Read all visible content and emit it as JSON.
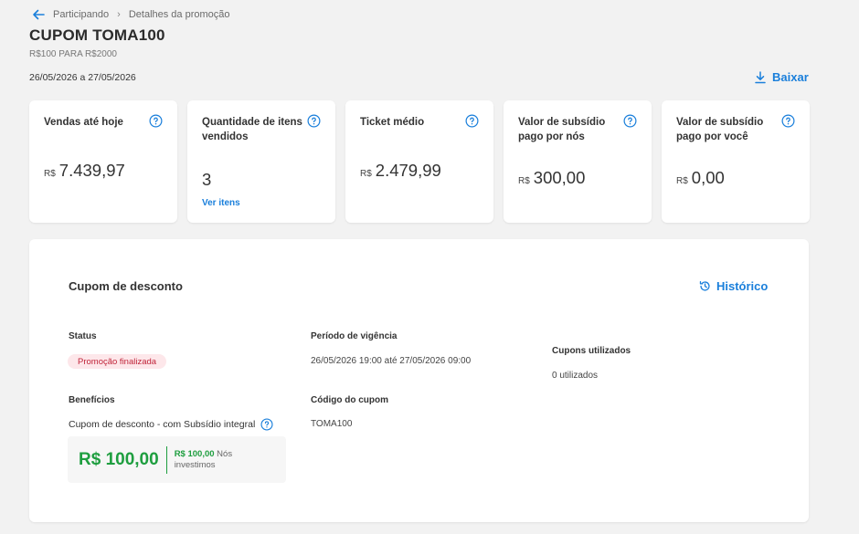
{
  "breadcrumb": {
    "parent": "Participando",
    "current": "Detalhes da promoção"
  },
  "header": {
    "title": "CUPOM TOMA100",
    "subtitle": "R$100 PARA R$2000",
    "date_range": "26/05/2026 a 27/05/2026",
    "download_label": "Baixar"
  },
  "cards": [
    {
      "label": "Vendas até hoje",
      "currency": "R$",
      "value": "7.439,97"
    },
    {
      "label": "Quantidade de itens vendidos",
      "currency": "",
      "value": "3",
      "link": "Ver itens"
    },
    {
      "label": "Ticket médio",
      "currency": "R$",
      "value": "2.479,99"
    },
    {
      "label": "Valor de subsídio pago por nós",
      "currency": "R$",
      "value": "300,00"
    },
    {
      "label": "Valor de subsídio pago por você",
      "currency": "R$",
      "value": "0,00"
    }
  ],
  "panel": {
    "title": "Cupom de desconto",
    "history_label": "Histórico",
    "status_label": "Status",
    "status_value": "Promoção finalizada",
    "period_label": "Período de vigência",
    "period_value": "26/05/2026 19:00 até 27/05/2026 09:00",
    "coupons_used_label": "Cupons utilizados",
    "coupons_used_value": "0 utilizados",
    "benefits_label": "Benefícios",
    "benefits_value": "Cupom de desconto - com Subsídio integral",
    "benefit_amount": "R$ 100,00",
    "benefit_note_amount": "R$ 100,00",
    "benefit_note_text": "Nós investimos",
    "code_label": "Código do cupom",
    "code_value": "TOMA100"
  },
  "colors": {
    "accent": "#1a7fdb",
    "success": "#1e9e3f",
    "danger": "#c0253a"
  }
}
